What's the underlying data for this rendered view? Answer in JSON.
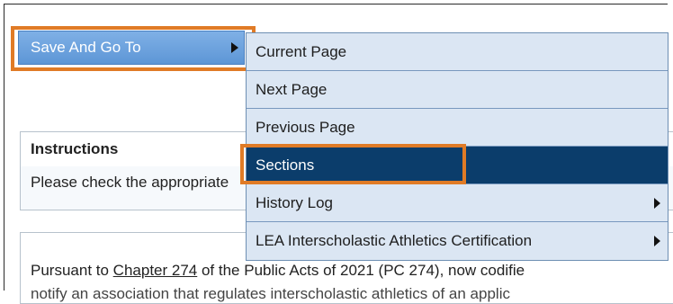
{
  "save_menu": {
    "label": "Save And Go To"
  },
  "submenu": {
    "items": [
      {
        "label": "Current Page",
        "has_submenu": false,
        "selected": false
      },
      {
        "label": "Next Page",
        "has_submenu": false,
        "selected": false
      },
      {
        "label": "Previous Page",
        "has_submenu": false,
        "selected": false
      },
      {
        "label": "Sections",
        "has_submenu": false,
        "selected": true
      },
      {
        "label": "History Log",
        "has_submenu": true,
        "selected": false
      },
      {
        "label": "LEA Interscholastic Athletics Certification",
        "has_submenu": true,
        "selected": false
      }
    ]
  },
  "instructions": {
    "title": "Instructions",
    "body": "Please check the appropriate"
  },
  "pursuant": {
    "prefix": "Pursuant to ",
    "link": "Chapter 274",
    "suffix": " of the Public Acts of 2021 (PC 274), now codifie",
    "cut_line": "notify an association that regulates interscholastic athletics of an applic"
  },
  "colors": {
    "highlight": "#e07b26",
    "selected_bg": "#0b3d6b",
    "menu_bg": "#dbe6f3",
    "button_bg": "#6ea3e0"
  }
}
